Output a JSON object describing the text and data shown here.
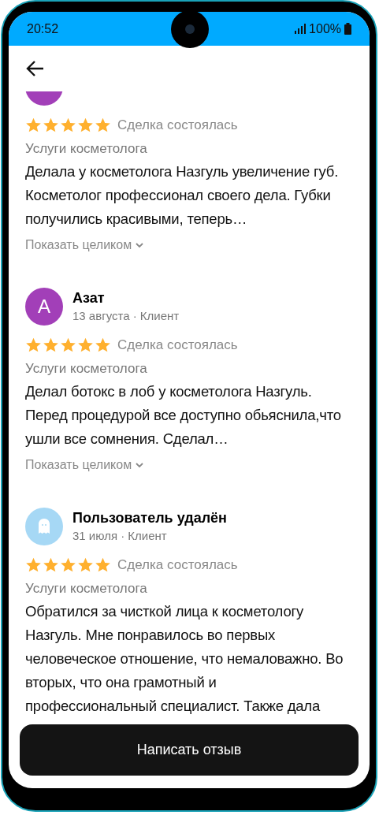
{
  "status_bar": {
    "time": "20:52",
    "battery": "100%"
  },
  "reviews": [
    {
      "kind": "clipped",
      "color": "#a23fb8",
      "stars": 5,
      "deal": "Сделка состоялась",
      "service": "Услуги косметолога",
      "text": "Делала у косметолога Назгуль увеличение губ. Косметолог профессионал своего дела. Губки получились красивыми, теперь…",
      "more": "Показать целиком"
    },
    {
      "kind": "letter",
      "color": "#a23fb8",
      "initial": "А",
      "name": "Азат",
      "meta": "13 августа · Клиент",
      "stars": 5,
      "deal": "Сделка состоялась",
      "service": "Услуги косметолога",
      "text": "Делал ботокс в лоб у косметолога Назгуль. Перед процедурой все доступно обьяснила,что ушли все сомнения. Сделал…",
      "more": "Показать целиком"
    },
    {
      "kind": "deleted",
      "color": "#a6d8f5",
      "name": "Пользователь удалён",
      "meta": "31 июля · Клиент",
      "stars": 5,
      "deal": "Сделка состоялась",
      "service": "Услуги косметолога",
      "text": "Обратился за чисткой лица к косметологу Назгуль. Мне понравилось во первых человеческое отношение, что немаловажно. Во вторых, что она грамотный и профессиональный специалист. Также дала"
    }
  ],
  "button": "Написать отзыв"
}
